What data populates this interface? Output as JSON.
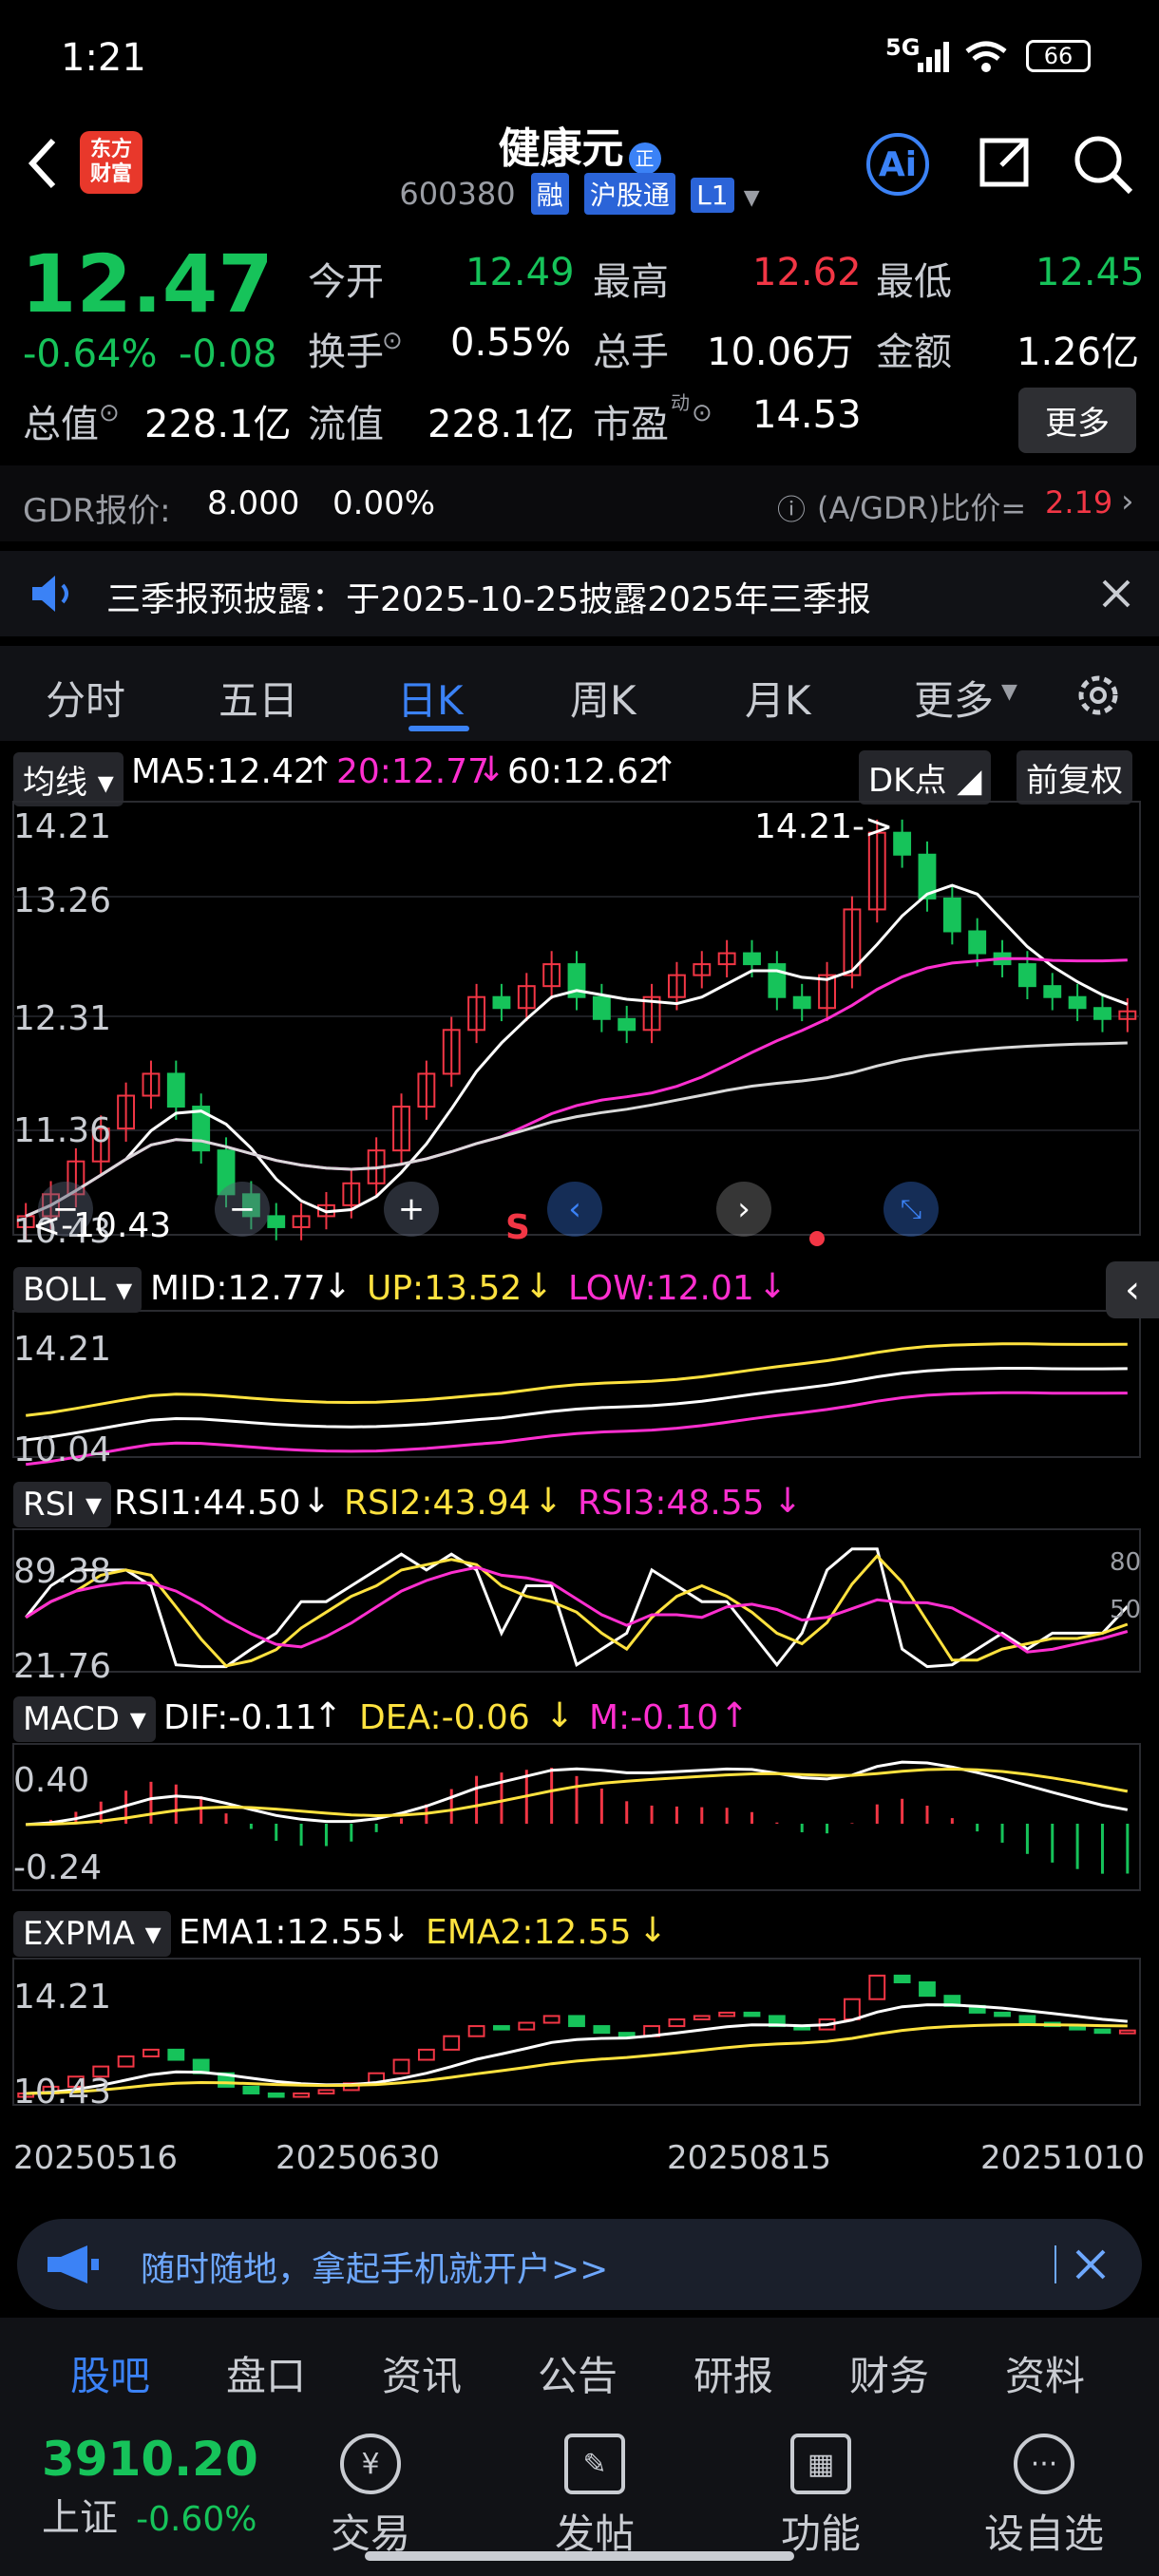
{
  "status": {
    "time": "1:21",
    "network": "5G",
    "battery": "66"
  },
  "header": {
    "logo_line1": "东方",
    "logo_line2": "财富",
    "stock_name": "健康元",
    "stock_code": "600380",
    "badges": [
      "融",
      "沪股通",
      "L1"
    ],
    "ai_label": "Ai"
  },
  "quote": {
    "price": "12.47",
    "change_pct": "-0.64%",
    "change": "-0.08",
    "open_label": "今开",
    "open": "12.49",
    "high_label": "最高",
    "high": "12.62",
    "low_label": "最低",
    "low": "12.45",
    "turnover_label": "换手",
    "turnover": "0.55%",
    "volume_label": "总手",
    "volume": "10.06万",
    "amount_label": "金额",
    "amount": "1.26亿",
    "mcap_label": "总值",
    "mcap": "228.1亿",
    "float_label": "流值",
    "float": "228.1亿",
    "pe_label": "市盈",
    "pe_sup": "动",
    "pe": "14.53",
    "more_label": "更多"
  },
  "gdr": {
    "label": "GDR报价:",
    "price": "8.000",
    "pct": "0.00%",
    "ratio_label": "(A/GDR)比价=",
    "ratio": "2.19"
  },
  "notice": {
    "text": "三季报预披露：于2025-10-25披露2025年三季报"
  },
  "tabs": [
    "分时",
    "五日",
    "日K",
    "周K",
    "月K",
    "更多"
  ],
  "active_tab": "日K",
  "chart": {
    "ma_pill": "均线",
    "ma5": "MA5:12.42",
    "ma20": "20:12.77",
    "ma60": "60:12.62",
    "dk_label": "DK点",
    "adj_label": "前复权",
    "y_labels": [
      "14.21",
      "13.26",
      "12.31",
      "11.36",
      "10.43"
    ],
    "max_annot": "14.21->",
    "min_annot": "<-10.43",
    "s_marker": "S",
    "boll": {
      "pill": "BOLL",
      "mid": "MID:12.77",
      "up": "UP:13.52",
      "low": "LOW:12.01",
      "y_top": "14.21",
      "y_bot": "10.04"
    },
    "rsi": {
      "pill": "RSI",
      "rsi1": "RSI1:44.50",
      "rsi2": "RSI2:43.94",
      "rsi3": "RSI3:48.55",
      "y_top": "89.38",
      "y_bot": "21.76",
      "lvl80": "80",
      "lvl50": "50"
    },
    "macd": {
      "pill": "MACD",
      "dif": "DIF:-0.11",
      "dea": "DEA:-0.06",
      "m": "M:-0.10",
      "y_top": "0.40",
      "y_bot": "-0.24"
    },
    "expma": {
      "pill": "EXPMA",
      "ema1": "EMA1:12.55",
      "ema2": "EMA2:12.55",
      "y_top": "14.21",
      "y_bot": "10.43"
    },
    "dates": [
      "20250516",
      "20250630",
      "20250815",
      "20251010"
    ]
  },
  "chart_data": {
    "type": "candlestick",
    "dates_shown": [
      "20250516",
      "20250630",
      "20250815",
      "20251010"
    ],
    "ylim": [
      10.43,
      14.21
    ],
    "close_approx": [
      10.6,
      10.8,
      11.1,
      11.4,
      11.7,
      11.9,
      11.6,
      11.2,
      10.8,
      10.6,
      10.5,
      10.6,
      10.7,
      10.9,
      11.2,
      11.6,
      11.9,
      12.3,
      12.6,
      12.5,
      12.7,
      12.9,
      12.6,
      12.4,
      12.3,
      12.6,
      12.8,
      12.9,
      13.0,
      12.9,
      12.6,
      12.5,
      12.8,
      13.4,
      14.1,
      13.9,
      13.5,
      13.2,
      13.0,
      12.9,
      12.7,
      12.6,
      12.5,
      12.4,
      12.47
    ]
  },
  "ad": {
    "text": "随时随地，拿起手机就开户>>"
  },
  "bottom_tabs": [
    "股吧",
    "盘口",
    "资讯",
    "公告",
    "研报",
    "财务",
    "资料"
  ],
  "index": {
    "value": "3910.20",
    "name": "上证",
    "pct": "-0.60%"
  },
  "nav": [
    "交易",
    "发帖",
    "功能",
    "设自选"
  ]
}
